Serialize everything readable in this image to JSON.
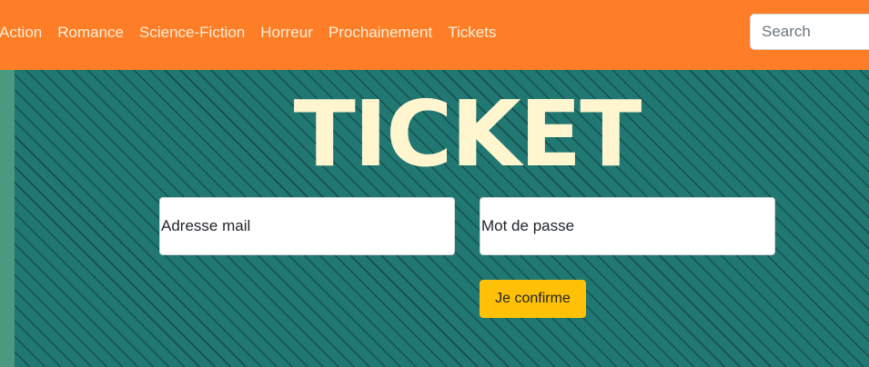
{
  "navbar": {
    "links": [
      "Action",
      "Romance",
      "Science-Fiction",
      "Horreur",
      "Prochainement",
      "Tickets"
    ],
    "search": {
      "placeholder": "Search",
      "value": ""
    }
  },
  "main": {
    "title": "TICKET",
    "form": {
      "email_placeholder": "Adresse mail",
      "password_placeholder": "Mot de passe",
      "confirm_label": "Je confirme"
    }
  },
  "colors": {
    "navbar_bg": "#fd7e26",
    "main_bg": "#217873",
    "stripe": "#154f4b",
    "title": "#fff6d0",
    "button": "#ffc107"
  }
}
